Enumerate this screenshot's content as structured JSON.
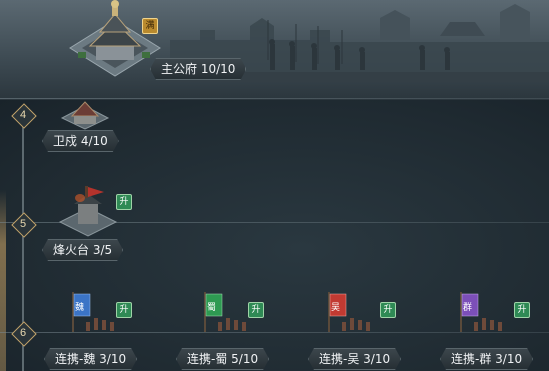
{
  "buildings": {
    "main": {
      "name": "主公府 10/10",
      "badge": "满"
    },
    "garrison": {
      "name": "卫戍 4/10"
    },
    "beacon": {
      "name": "烽火台 3/5",
      "badge": "升"
    },
    "wei": {
      "name": "连携-魏 3/10",
      "badge": "升",
      "flag_char": "魏",
      "flag_color": "#3b74c6"
    },
    "shu": {
      "name": "连携-蜀 5/10",
      "badge": "升",
      "flag_char": "蜀",
      "flag_color": "#2e9a52"
    },
    "wu": {
      "name": "连携-吴 3/10",
      "badge": "升",
      "flag_char": "吴",
      "flag_color": "#c23a32"
    },
    "qun": {
      "name": "连携-群 3/10",
      "badge": "升",
      "flag_char": "群",
      "flag_color": "#7c4fb8"
    }
  },
  "levels": [
    "4",
    "5",
    "6"
  ],
  "colors": {
    "accent_gold": "#c4a46a",
    "upgrade_green": "#2f8a55",
    "full_gold": "#b98a2e"
  }
}
